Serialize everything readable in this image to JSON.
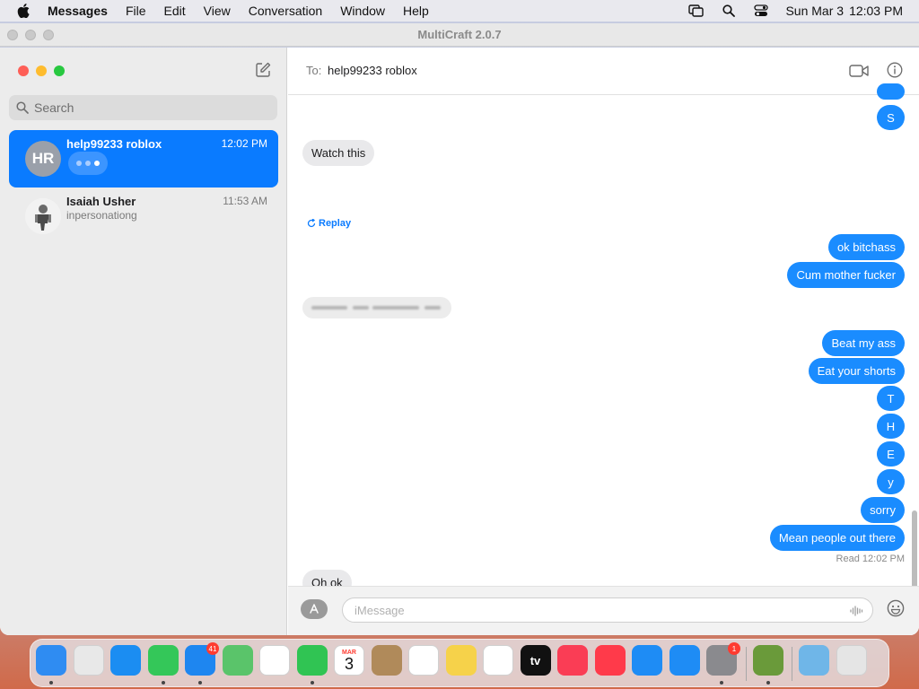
{
  "menubar": {
    "app": "Messages",
    "items": [
      "File",
      "Edit",
      "View",
      "Conversation",
      "Window",
      "Help"
    ],
    "date": "Sun Mar 3",
    "time": "12:03 PM"
  },
  "background_window": {
    "title": "MultiCraft 2.0.7"
  },
  "sidebar": {
    "search_placeholder": "Search",
    "conversations": [
      {
        "initials": "HR",
        "name": "help99233 roblox",
        "time": "12:02 PM",
        "preview": "",
        "typing": true,
        "selected": true
      },
      {
        "initials": "",
        "name": "Isaiah Usher",
        "time": "11:53 AM",
        "preview": "inpersonationg",
        "typing": false,
        "selected": false
      }
    ]
  },
  "header": {
    "to_label": "To:",
    "recipient": "help99233 roblox"
  },
  "thread": {
    "messages": [
      {
        "dir": "out",
        "text": "S"
      },
      {
        "dir": "in",
        "text": "Watch this"
      },
      {
        "dir": "out",
        "text": "ok bitchass"
      },
      {
        "dir": "out",
        "text": "Cum mother fucker"
      },
      {
        "dir": "out",
        "text": "Beat my ass"
      },
      {
        "dir": "out",
        "text": "Eat your shorts"
      },
      {
        "dir": "out",
        "text": "T"
      },
      {
        "dir": "out",
        "text": "H"
      },
      {
        "dir": "out",
        "text": "E"
      },
      {
        "dir": "out",
        "text": "y"
      },
      {
        "dir": "out",
        "text": "sorry"
      },
      {
        "dir": "out",
        "text": "Mean people out there"
      },
      {
        "dir": "in",
        "text": "Oh ok"
      }
    ],
    "replay_label": "Replay",
    "read_label": "Read",
    "read_time": "12:02 PM"
  },
  "input": {
    "placeholder": "iMessage"
  },
  "dock": {
    "apps": [
      {
        "name": "Finder",
        "color": "#2f8cf2",
        "running": true
      },
      {
        "name": "Launchpad",
        "color": "#e8e8e8",
        "running": false
      },
      {
        "name": "Safari",
        "color": "#1b8df2",
        "running": false
      },
      {
        "name": "Messages",
        "color": "#34c759",
        "running": true
      },
      {
        "name": "Mail",
        "color": "#1e86f0",
        "running": true,
        "badge": "41"
      },
      {
        "name": "Maps",
        "color": "#5ac46a",
        "running": false
      },
      {
        "name": "Photos",
        "color": "#ffffff",
        "running": false
      },
      {
        "name": "FaceTime",
        "color": "#30c453",
        "running": true
      },
      {
        "name": "Calendar",
        "color": "#ffffff",
        "running": false,
        "label_top": "MAR",
        "label_main": "3"
      },
      {
        "name": "Contacts",
        "color": "#b08a5a",
        "running": false
      },
      {
        "name": "Reminders",
        "color": "#ffffff",
        "running": false
      },
      {
        "name": "Notes",
        "color": "#f6d24a",
        "running": false
      },
      {
        "name": "Freeform",
        "color": "#ffffff",
        "running": false
      },
      {
        "name": "TV",
        "color": "#111111",
        "running": false,
        "label_main": "tv"
      },
      {
        "name": "Music",
        "color": "#fa3d55",
        "running": false
      },
      {
        "name": "News",
        "color": "#ff3a4a",
        "running": false
      },
      {
        "name": "Keynote",
        "color": "#1e8cf5",
        "running": false
      },
      {
        "name": "App Store",
        "color": "#1e8cf5",
        "running": false
      },
      {
        "name": "System Settings",
        "color": "#8a8a8e",
        "running": true,
        "badge": "1"
      },
      {
        "name": "MultiCraft",
        "color": "#6a9a3a",
        "running": true
      },
      {
        "name": "Downloads",
        "color": "#6fb6e8",
        "running": false
      },
      {
        "name": "Trash",
        "color": "#e5e5e5",
        "running": false
      }
    ]
  }
}
